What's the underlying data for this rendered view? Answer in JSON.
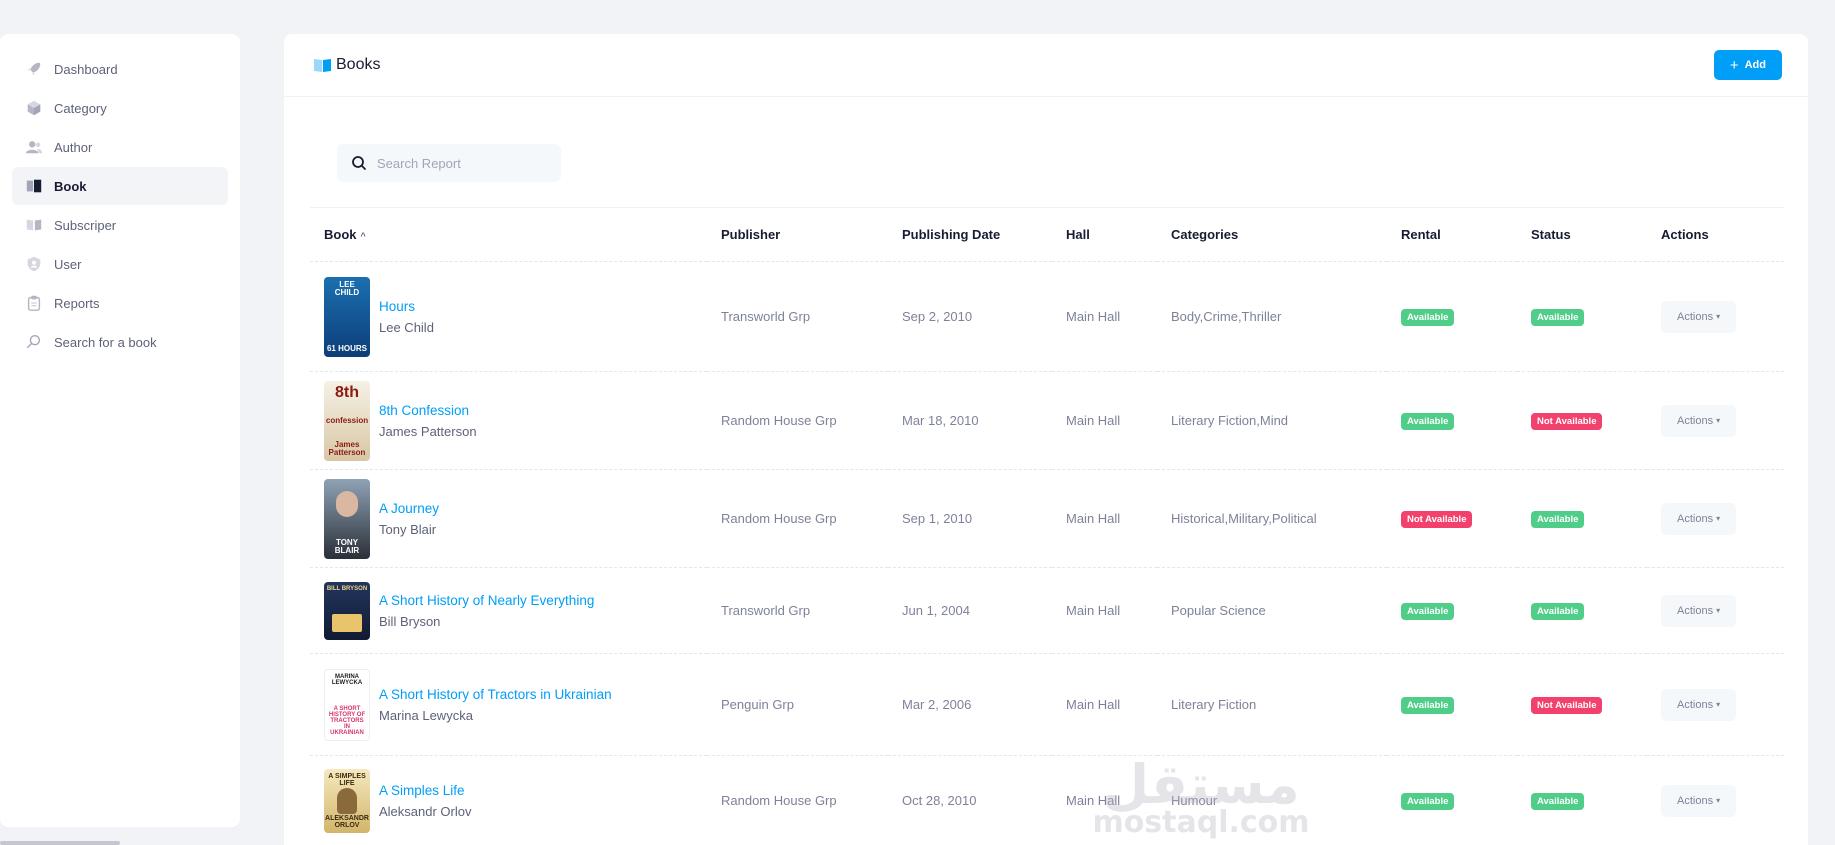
{
  "sidebar": {
    "items": [
      {
        "label": "Dashboard",
        "icon": "rocket-icon",
        "active": false
      },
      {
        "label": "Category",
        "icon": "cube-icon",
        "active": false
      },
      {
        "label": "Author",
        "icon": "users-icon",
        "active": false
      },
      {
        "label": "Book",
        "icon": "book-icon",
        "active": true
      },
      {
        "label": "Subscriper",
        "icon": "book-open-icon",
        "active": false
      },
      {
        "label": "User",
        "icon": "shield-user-icon",
        "active": false
      },
      {
        "label": "Reports",
        "icon": "clipboard-icon",
        "active": false
      },
      {
        "label": "Search for a book",
        "icon": "search-icon",
        "active": false
      }
    ]
  },
  "header": {
    "title": "Books",
    "add_label": "Add"
  },
  "search": {
    "placeholder": "Search Report",
    "value": ""
  },
  "table": {
    "columns": [
      "Book",
      "Publisher",
      "Publishing Date",
      "Hall",
      "Categories",
      "Rental",
      "Status",
      "Actions"
    ],
    "sort_column": "Book",
    "sort_direction": "asc",
    "actions_label": "Actions",
    "rows": [
      {
        "title": "Hours",
        "author": "Lee Child",
        "cover_lines": [
          "LEE CHILD",
          "61 HOURS"
        ],
        "publisher": "Transworld Grp",
        "date": "Sep 2, 2010",
        "hall": "Main Hall",
        "categories": "Body,Crime,Thriller",
        "rental": "Available",
        "status": "Available"
      },
      {
        "title": "8th Confession",
        "author": "James Patterson",
        "cover_lines": [
          "8th",
          "confession",
          "James Patterson"
        ],
        "publisher": "Random House Grp",
        "date": "Mar 18, 2010",
        "hall": "Main Hall",
        "categories": "Literary Fiction,Mind",
        "rental": "Available",
        "status": "Not Available"
      },
      {
        "title": "A Journey",
        "author": "Tony Blair",
        "cover_lines": [
          "TONY BLAIR"
        ],
        "publisher": "Random House Grp",
        "date": "Sep 1, 2010",
        "hall": "Main Hall",
        "categories": "Historical,Military,Political",
        "rental": "Not Available",
        "status": "Available"
      },
      {
        "title": "A Short History of Nearly Everything",
        "author": "Bill Bryson",
        "cover_lines": [
          "BILL BRYSON"
        ],
        "publisher": "Transworld Grp",
        "date": "Jun 1, 2004",
        "hall": "Main Hall",
        "categories": "Popular Science",
        "rental": "Available",
        "status": "Available"
      },
      {
        "title": "A Short History of Tractors in Ukrainian",
        "author": "Marina Lewycka",
        "cover_lines": [
          "MARINA LEWYCKA",
          "A SHORT HISTORY OF TRACTORS IN UKRAINIAN"
        ],
        "publisher": "Penguin Grp",
        "date": "Mar 2, 2006",
        "hall": "Main Hall",
        "categories": "Literary Fiction",
        "rental": "Available",
        "status": "Not Available"
      },
      {
        "title": "A Simples Life",
        "author": "Aleksandr Orlov",
        "cover_lines": [
          "A SIMPLES LIFE",
          "ALEKSANDR ORLOV"
        ],
        "publisher": "Random House Grp",
        "date": "Oct 28, 2010",
        "hall": "Main Hall",
        "categories": "Humour",
        "rental": "Available",
        "status": "Available"
      }
    ]
  },
  "watermark": {
    "arabic": "مستقل",
    "latin": "mostaql.com"
  },
  "colors": {
    "primary": "#009ef7",
    "success": "#50cd89",
    "danger": "#f1416c",
    "background": "#f1f3f6"
  }
}
